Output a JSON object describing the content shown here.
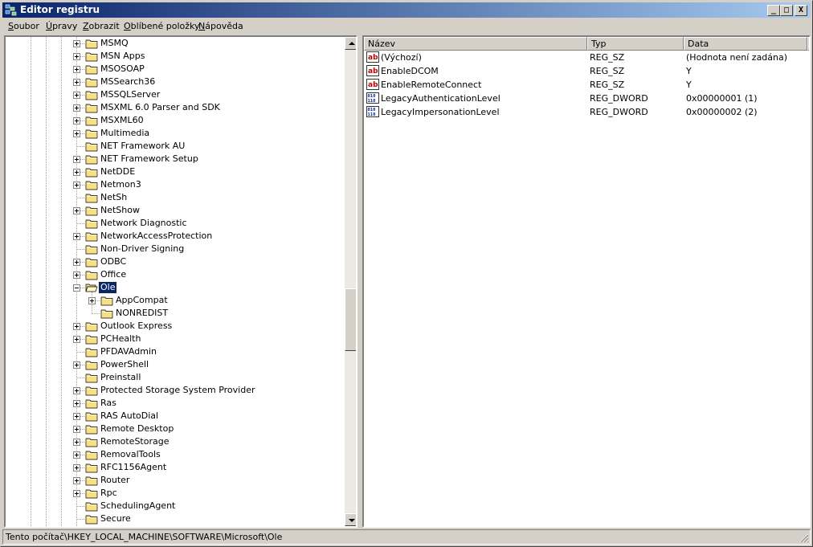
{
  "window": {
    "title": "Editor registru",
    "controls": [
      "_",
      "□",
      "X"
    ]
  },
  "menu": [
    {
      "label": "Soubor",
      "accel": "S",
      "rest": "oubor"
    },
    {
      "label": "Úpravy",
      "accel": "Ú",
      "rest": "pravy"
    },
    {
      "label": "Zobrazit",
      "accel": "Z",
      "rest": "obrazit"
    },
    {
      "label": "Oblíbené položky",
      "accel": "O",
      "rest": "blíbené položky"
    },
    {
      "label": "Nápověda",
      "accel": "N",
      "rest": "ápověda"
    }
  ],
  "tree": {
    "items": [
      {
        "label": "MSMQ",
        "expander": "plus",
        "depth": 0
      },
      {
        "label": "MSN Apps",
        "expander": "plus",
        "depth": 0
      },
      {
        "label": "MSOSOAP",
        "expander": "plus",
        "depth": 0
      },
      {
        "label": "MSSearch36",
        "expander": "plus",
        "depth": 0
      },
      {
        "label": "MSSQLServer",
        "expander": "plus",
        "depth": 0
      },
      {
        "label": "MSXML 6.0 Parser and SDK",
        "expander": "plus",
        "depth": 0
      },
      {
        "label": "MSXML60",
        "expander": "plus",
        "depth": 0
      },
      {
        "label": "Multimedia",
        "expander": "plus",
        "depth": 0
      },
      {
        "label": "NET Framework AU",
        "expander": "none",
        "depth": 0
      },
      {
        "label": "NET Framework Setup",
        "expander": "plus",
        "depth": 0
      },
      {
        "label": "NetDDE",
        "expander": "plus",
        "depth": 0
      },
      {
        "label": "Netmon3",
        "expander": "plus",
        "depth": 0
      },
      {
        "label": "NetSh",
        "expander": "none",
        "depth": 0
      },
      {
        "label": "NetShow",
        "expander": "plus",
        "depth": 0
      },
      {
        "label": "Network Diagnostic",
        "expander": "none",
        "depth": 0
      },
      {
        "label": "NetworkAccessProtection",
        "expander": "plus",
        "depth": 0
      },
      {
        "label": "Non-Driver Signing",
        "expander": "none",
        "depth": 0
      },
      {
        "label": "ODBC",
        "expander": "plus",
        "depth": 0
      },
      {
        "label": "Office",
        "expander": "plus",
        "depth": 0
      },
      {
        "label": "Ole",
        "expander": "minus",
        "depth": 0,
        "selected": true,
        "open": true
      },
      {
        "label": "AppCompat",
        "expander": "plus",
        "depth": 1
      },
      {
        "label": "NONREDIST",
        "expander": "none",
        "depth": 1
      },
      {
        "label": "Outlook Express",
        "expander": "plus",
        "depth": 0
      },
      {
        "label": "PCHealth",
        "expander": "plus",
        "depth": 0
      },
      {
        "label": "PFDAVAdmin",
        "expander": "none",
        "depth": 0
      },
      {
        "label": "PowerShell",
        "expander": "plus",
        "depth": 0
      },
      {
        "label": "Preinstall",
        "expander": "none",
        "depth": 0
      },
      {
        "label": "Protected Storage System Provider",
        "expander": "plus",
        "depth": 0
      },
      {
        "label": "Ras",
        "expander": "plus",
        "depth": 0
      },
      {
        "label": "RAS AutoDial",
        "expander": "plus",
        "depth": 0
      },
      {
        "label": "Remote Desktop",
        "expander": "plus",
        "depth": 0
      },
      {
        "label": "RemoteStorage",
        "expander": "plus",
        "depth": 0
      },
      {
        "label": "RemovalTools",
        "expander": "plus",
        "depth": 0
      },
      {
        "label": "RFC1156Agent",
        "expander": "plus",
        "depth": 0
      },
      {
        "label": "Router",
        "expander": "plus",
        "depth": 0
      },
      {
        "label": "Rpc",
        "expander": "plus",
        "depth": 0
      },
      {
        "label": "SchedulingAgent",
        "expander": "none",
        "depth": 0
      },
      {
        "label": "Secure",
        "expander": "none",
        "depth": 0
      }
    ],
    "scroll_position": 0.52
  },
  "values": {
    "columns": [
      "Název",
      "Typ",
      "Data"
    ],
    "rows": [
      {
        "name": "(Výchozí)",
        "type": "REG_SZ",
        "data": "(Hodnota není zadána)",
        "icon": "string-value-icon"
      },
      {
        "name": "EnableDCOM",
        "type": "REG_SZ",
        "data": "Y",
        "icon": "string-value-icon"
      },
      {
        "name": "EnableRemoteConnect",
        "type": "REG_SZ",
        "data": "Y",
        "icon": "string-value-icon"
      },
      {
        "name": "LegacyAuthenticationLevel",
        "type": "REG_DWORD",
        "data": "0x00000001 (1)",
        "icon": "binary-value-icon"
      },
      {
        "name": "LegacyImpersonationLevel",
        "type": "REG_DWORD",
        "data": "0x00000002 (2)",
        "icon": "binary-value-icon"
      }
    ]
  },
  "status": {
    "path": "Tento počítač\\HKEY_LOCAL_MACHINE\\SOFTWARE\\Microsoft\\Ole"
  },
  "colors": {
    "title_start": "#0a246a",
    "title_end": "#a6caf0",
    "selection": "#0a246a",
    "face": "#d4d0c8",
    "folder": "#f8e088"
  }
}
